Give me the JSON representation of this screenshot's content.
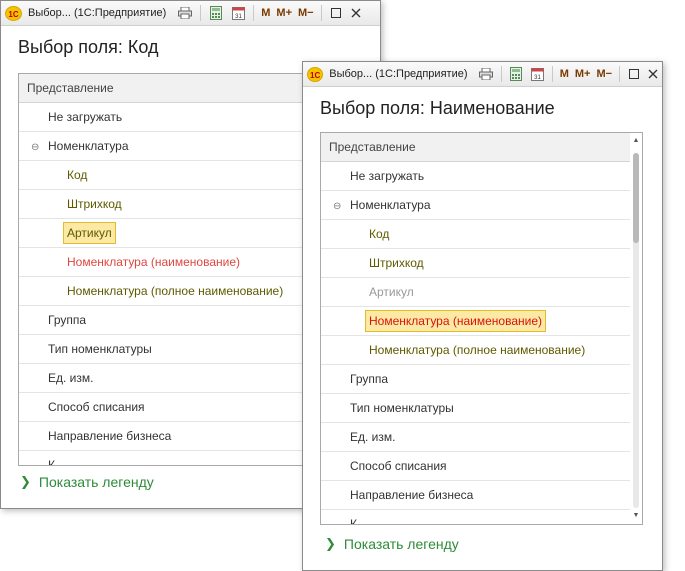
{
  "back_window": {
    "title": "Выбор...  (1С:Предприятие)",
    "form_title": "Выбор поля: Код",
    "column_header": "Представление",
    "rows": {
      "r0": "Не загружать",
      "r1": "Номенклатура",
      "r2": "Код",
      "r3": "Штрихкод",
      "r4": "Артикул",
      "r5": "Номенклатура (наименование)",
      "r6": "Номенклатура (полное наименование)",
      "r7": "Группа",
      "r8": "Тип номенклатуры",
      "r9": "Ед. изм.",
      "r10": "Способ списания",
      "r11": "Направление бизнеса",
      "r12": "К..."
    },
    "legend": "Показать легенду",
    "selected": "Артикул"
  },
  "front_window": {
    "title": "Выбор...  (1С:Предприятие)",
    "form_title": "Выбор поля: Наименование",
    "column_header": "Представление",
    "rows": {
      "r0": "Не загружать",
      "r1": "Номенклатура",
      "r2": "Код",
      "r3": "Штрихкод",
      "r4": "Артикул",
      "r5": "Номенклатура (наименование)",
      "r6": "Номенклатура (полное наименование)",
      "r7": "Группа",
      "r8": "Тип номенклатуры",
      "r9": "Ед. изм.",
      "r10": "Способ списания",
      "r11": "Направление бизнеса",
      "r12": "К..."
    },
    "legend": "Показать легенду",
    "selected": "Номенклатура (наименование)"
  },
  "toolbar": {
    "logo": "1С",
    "m": "M",
    "m_plus": "M+",
    "m_minus": "M−",
    "calendar_day": "31"
  },
  "colors": {
    "legend_green": "#2e8b3a",
    "sub_item_olive": "#5f5a00",
    "used_red": "#e0473f",
    "highlight_bg": "#fbe9a4",
    "highlight_border": "#e3bc2e"
  }
}
